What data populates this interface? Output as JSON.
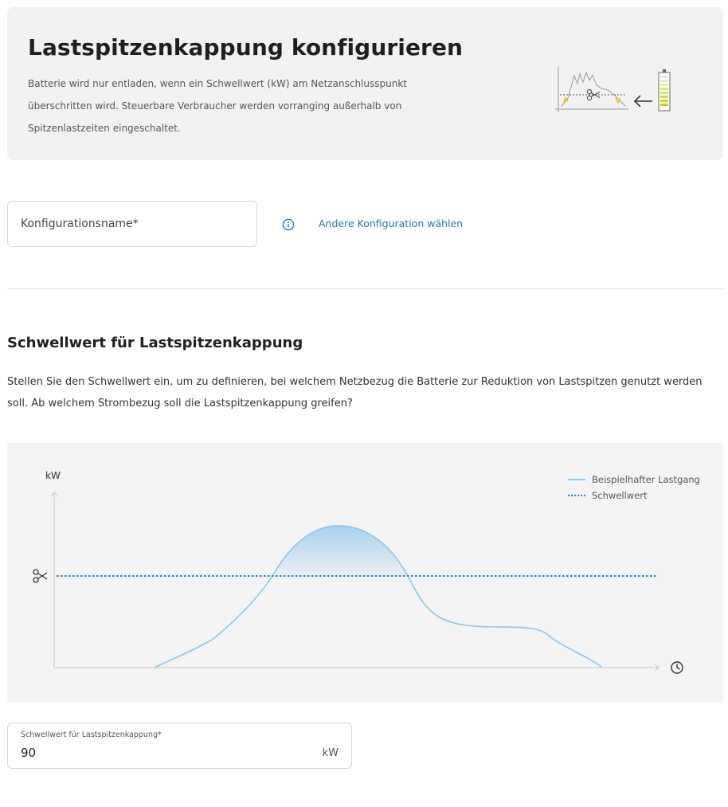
{
  "header": {
    "title": "Lastspitzenkappung konfigurieren",
    "description": "Batterie wird nur entladen, wenn ein Schwellwert (kW) am Netzanschlusspunkt überschritten wird. Steuerbare Verbraucher werden vorranging außerhalb von Spitzenlastzeiten eingeschaltet."
  },
  "config": {
    "name_placeholder": "Konfigurationsname*",
    "name_value": "",
    "other_link": "Andere Konfiguration wählen"
  },
  "section": {
    "title": "Schwellwert für Lastspitzenkappung",
    "description": "Stellen Sie den Schwellwert ein, um zu definieren, bei welchem Netzbezug die Batterie zur Reduktion von Lastspitzen genutzt werden soll. Ab welchem Strombezug soll die Lastspitzenkappung greifen?"
  },
  "chart_data": {
    "type": "line",
    "ylabel": "kW",
    "xlabel": "",
    "legend_position": "top-right",
    "grid": false,
    "series": [
      {
        "name": "Beispielhafter Lastgang",
        "style": "solid",
        "color": "#8ec5ea"
      },
      {
        "name": "Schwellwert",
        "style": "dotted",
        "color": "#2a7ec9"
      }
    ],
    "icons": {
      "threshold_marker": "scissors-icon",
      "x_axis_end": "clock-icon"
    }
  },
  "threshold": {
    "label": "Schwellwert für Lastspitzenkappung*",
    "value": "90",
    "unit": "kW"
  },
  "colors": {
    "accent": "#2474c8",
    "panel_bg": "#f2f2f2",
    "curve": "#8ec5ea",
    "threshold_line": "#2a7ec9"
  }
}
